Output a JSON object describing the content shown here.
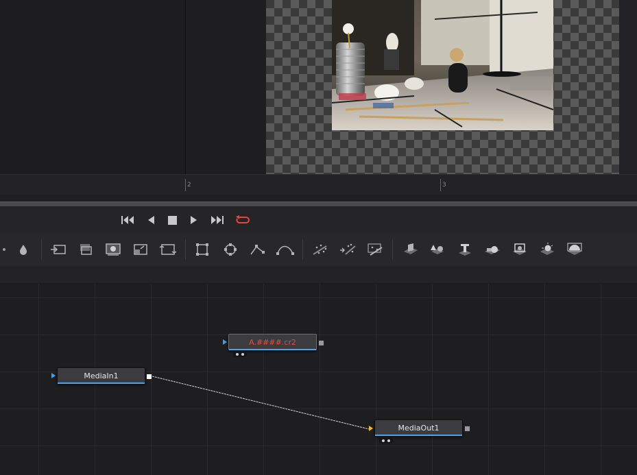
{
  "viewers": {
    "left_label": "",
    "right_label": ""
  },
  "ruler": {
    "ticks": [
      {
        "label": "2"
      },
      {
        "label": "3"
      }
    ]
  },
  "transport": {
    "buttons": [
      {
        "name": "go-to-start",
        "icon": "skip-back-icon"
      },
      {
        "name": "play-reverse",
        "icon": "play-reverse-icon"
      },
      {
        "name": "stop",
        "icon": "stop-icon"
      },
      {
        "name": "play-forward",
        "icon": "play-icon"
      },
      {
        "name": "go-to-end",
        "icon": "skip-forward-icon"
      },
      {
        "name": "loop",
        "icon": "loop-icon",
        "color": "#e8463a"
      }
    ]
  },
  "toolbar": {
    "tools": [
      "paint-icon",
      "drop-icon",
      "merge-icon",
      "background-icon",
      "matte-icon",
      "resize-icon",
      "transform-icon",
      "rectangle-mask-icon",
      "ellipse-mask-icon",
      "polygon-mask-icon",
      "bspline-mask-icon",
      "particle-emitter-icon",
      "particle-render-icon",
      "particle-region-icon",
      "shape3d-icon",
      "merge3d-icon",
      "text3d-icon",
      "camera3d-icon",
      "renderer3d-icon",
      "light3d-icon",
      "image-plane3d-icon"
    ]
  },
  "nodes": {
    "loader": {
      "label": "A.####.cr2"
    },
    "media_in": {
      "label": "MediaIn1"
    },
    "media_out": {
      "label": "MediaOut1"
    }
  },
  "colors": {
    "accent_blue": "#4da3e6",
    "selected_red": "#d9423a",
    "loop_red": "#e8463a"
  }
}
